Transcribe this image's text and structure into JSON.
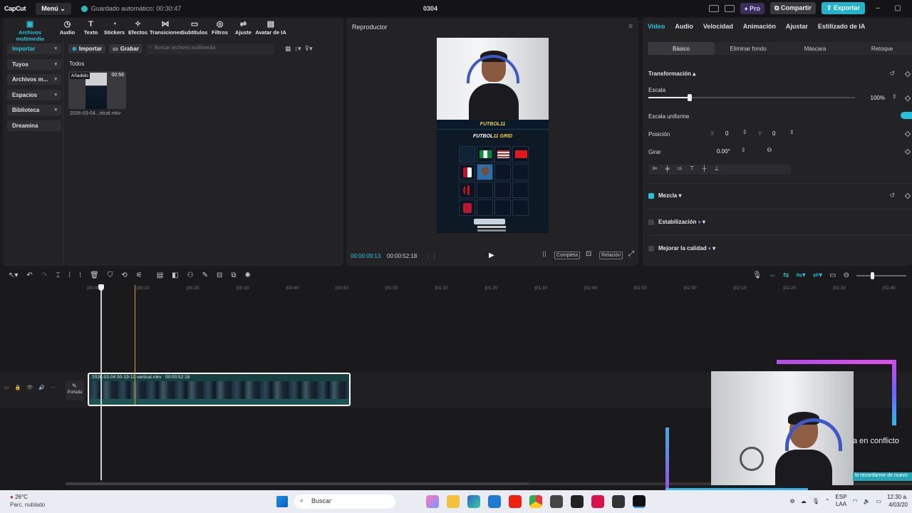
{
  "titlebar": {
    "logo": "CapCut",
    "menu_label": "Menú",
    "autosave": "Guardado automático: 00:30:47",
    "project_title": "0304",
    "pro_label": "Pro",
    "share_label": "Compartir",
    "export_label": "Exportar"
  },
  "toolbar": {
    "tabs": [
      {
        "label": "Archivos multimedia",
        "icon": "media-icon"
      },
      {
        "label": "Audio",
        "icon": "audio-icon"
      },
      {
        "label": "Texto",
        "icon": "text-icon"
      },
      {
        "label": "Stickers",
        "icon": "sticker-icon"
      },
      {
        "label": "Efectos",
        "icon": "effects-icon"
      },
      {
        "label": "Transiciones",
        "icon": "transitions-icon"
      },
      {
        "label": "Subtítulos",
        "icon": "subtitles-icon"
      },
      {
        "label": "Filtros",
        "icon": "filters-icon"
      },
      {
        "label": "Ajuste",
        "icon": "adjust-icon"
      },
      {
        "label": "Avatar de IA",
        "icon": "ai-avatar-icon"
      }
    ]
  },
  "media": {
    "side_nav": [
      "Importar",
      "Tuyos",
      "Archivos m...",
      "Espacios",
      "Biblioteca",
      "Dreamina"
    ],
    "import_label": "Importar",
    "record_label": "Grabar",
    "search_placeholder": "Buscar archivos multimedia",
    "section_label": "Todos",
    "item": {
      "badge": "Añadido",
      "duration": "00:56",
      "name": "2026-03-04...rtical.mkv"
    }
  },
  "player": {
    "title": "Reproductor",
    "current_time": "00:00:09:13",
    "total_time": "00:00:52:18",
    "full_label": "Completa",
    "ratio_label": "Relación",
    "preview": {
      "bar_text": "FUTBOL11",
      "grid_title_a": "FUTBOL",
      "grid_title_b": "11 GRID"
    }
  },
  "inspector": {
    "tabs": [
      "Video",
      "Audio",
      "Velocidad",
      "Animación",
      "Ajustar",
      "Estilizado de IA"
    ],
    "subtabs": [
      "Básico",
      "Eliminar fondo",
      "Máscara",
      "Retoque"
    ],
    "transform_title": "Transformación",
    "scale_label": "Escala",
    "scale_value": "100%",
    "scale_fraction": 0.2,
    "uniform_label": "Escala uniforme",
    "position_label": "Posición",
    "pos_x_label": "X",
    "pos_x": "0",
    "pos_y_label": "Y",
    "pos_y": "0",
    "rotate_label": "Girar",
    "rotate_value": "0.00°",
    "blend_label": "Mezcla",
    "stabilize_label": "Estabilización",
    "enhance_label": "Mejorar la calidad"
  },
  "timeline": {
    "ticks": [
      "00:00",
      "00:10",
      "00:20",
      "00:30",
      "00:40",
      "00:50",
      "01:00",
      "01:10",
      "01:20",
      "01:30",
      "01:40",
      "01:50",
      "02:00",
      "02:10",
      "02:20",
      "02:30",
      "02:40"
    ],
    "cover_label": "Portada",
    "clip_name": "2026-03-04 00-19-19-vertical.mkv",
    "clip_duration": "00:00:52:18"
  },
  "overlay": {
    "conflict_text": "a en conflicto",
    "remind_text": "lo recordarme de nuevo"
  },
  "taskbar": {
    "temp": "26°C",
    "weather": "Parc. nublado",
    "search_label": "Buscar",
    "lang1": "ESP",
    "lang2": "LAA",
    "time": "12:30 a.",
    "date": "4/03/20"
  },
  "colors": {
    "accent": "#25c1d8",
    "export": "#23b4cc",
    "pro": "#3a2e59"
  }
}
